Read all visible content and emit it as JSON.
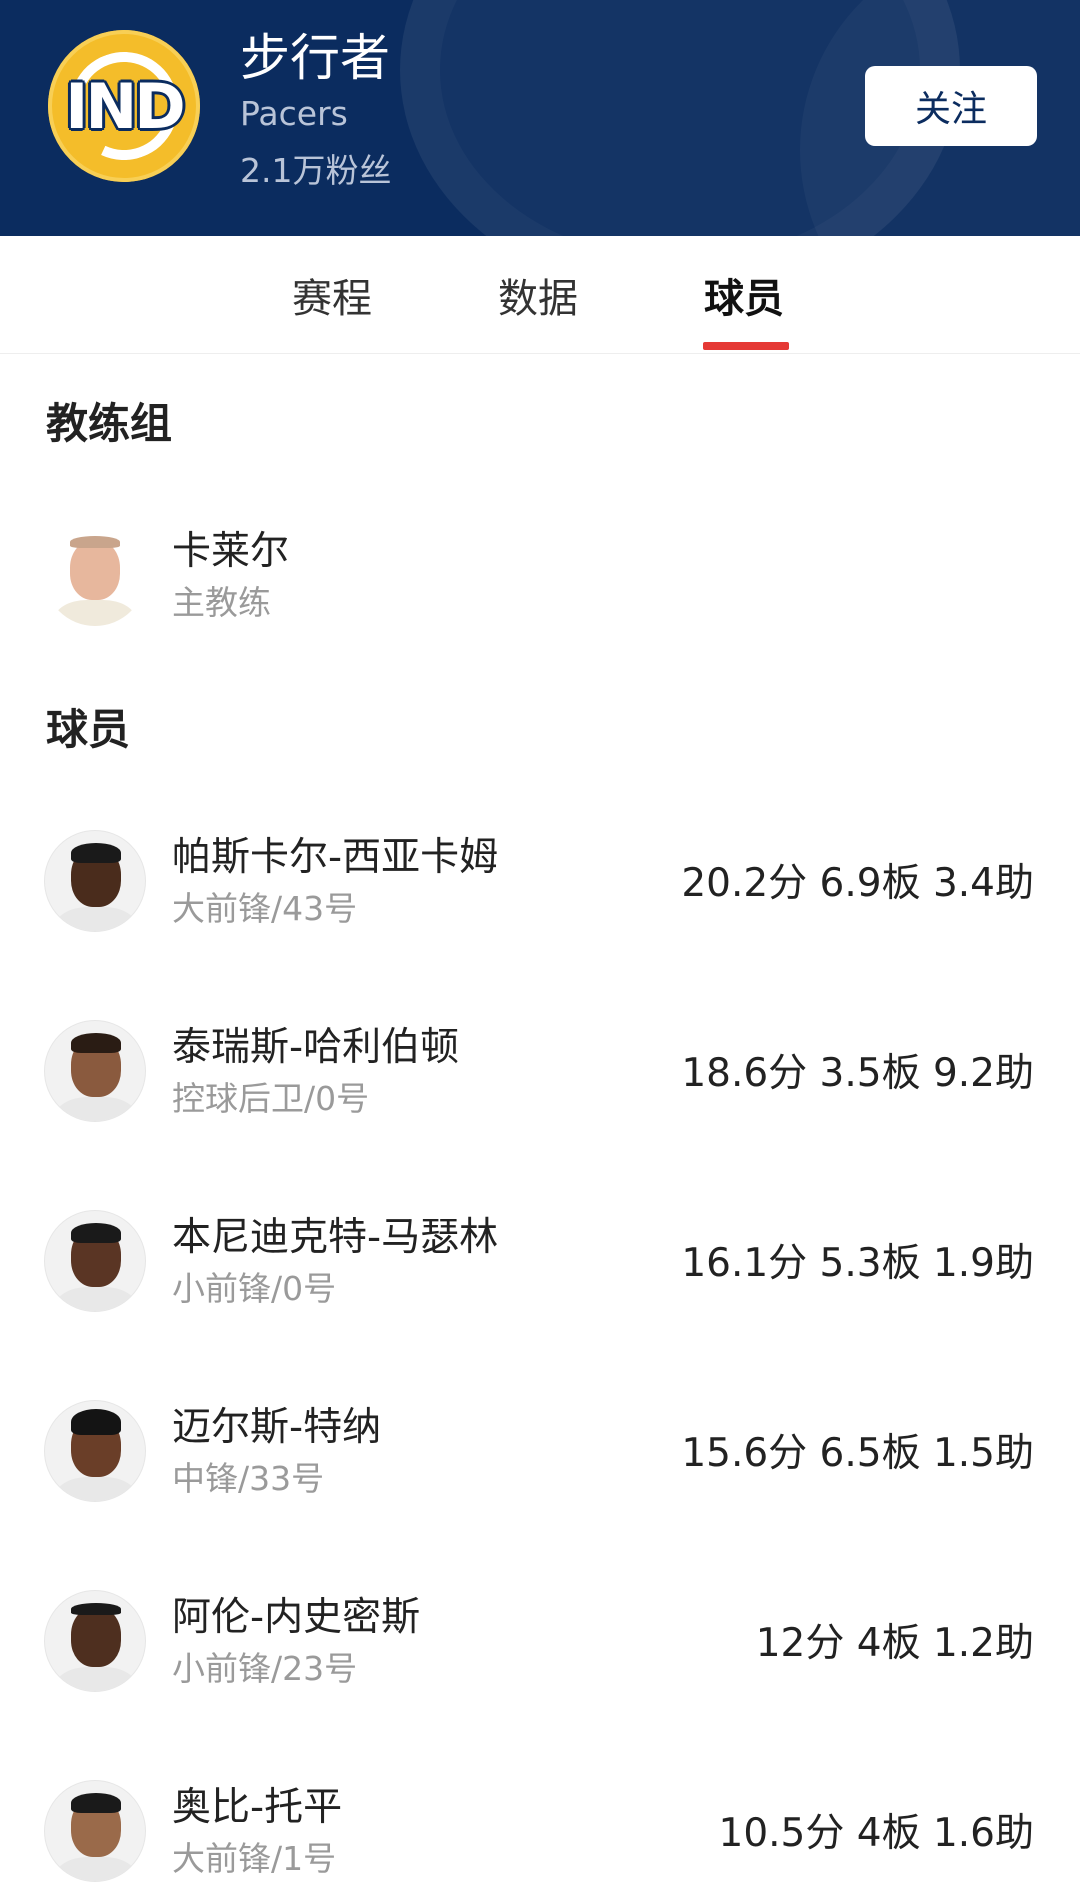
{
  "team": {
    "logo_text": "IND",
    "name": "步行者",
    "name_en": "Pacers",
    "fans": "2.1万粉丝",
    "follow_label": "关注"
  },
  "tabs": [
    {
      "label": "赛程",
      "active": false
    },
    {
      "label": "数据",
      "active": false
    },
    {
      "label": "球员",
      "active": true
    }
  ],
  "coaches": {
    "title": "教练组",
    "items": [
      {
        "name": "卡莱尔",
        "role": "主教练"
      }
    ]
  },
  "players": {
    "title": "球员",
    "items": [
      {
        "name": "帕斯卡尔-西亚卡姆",
        "position": "大前锋/43号",
        "stats": "20.2分 6.9板 3.4助"
      },
      {
        "name": "泰瑞斯-哈利伯顿",
        "position": "控球后卫/0号",
        "stats": "18.6分 3.5板 9.2助"
      },
      {
        "name": "本尼迪克特-马瑟林",
        "position": "小前锋/0号",
        "stats": "16.1分 5.3板 1.9助"
      },
      {
        "name": "迈尔斯-特纳",
        "position": "中锋/33号",
        "stats": "15.6分 6.5板 1.5助"
      },
      {
        "name": "阿伦-内史密斯",
        "position": "小前锋/23号",
        "stats": "12分 4板 1.2助"
      },
      {
        "name": "奥比-托平",
        "position": "大前锋/1号",
        "stats": "10.5分 4板 1.6助"
      }
    ]
  },
  "colors": {
    "header_bg": "#0b2c5f",
    "logo_gold": "#f4bd2a",
    "tab_indicator": "#e53935"
  }
}
